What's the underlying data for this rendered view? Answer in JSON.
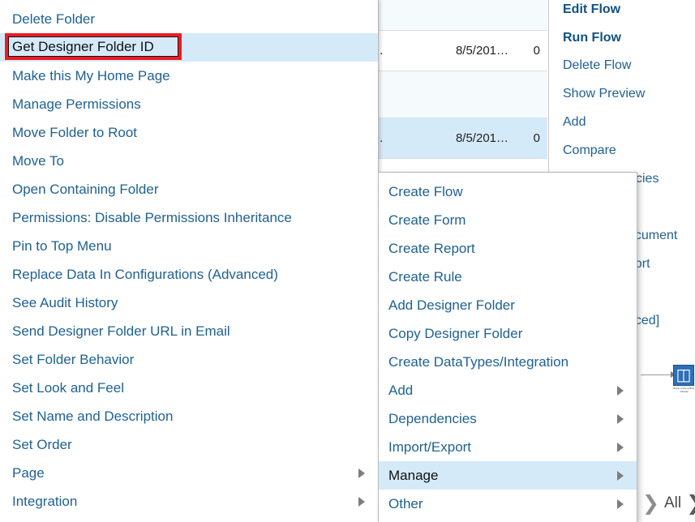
{
  "grid": {
    "rows": [
      {
        "truncated": "",
        "date": "",
        "count": "",
        "state": "alt"
      },
      {
        "truncated": "..",
        "date": "8/5/201…",
        "count": "0",
        "state": "white"
      },
      {
        "truncated": "",
        "date": "",
        "count": "",
        "state": "alt"
      },
      {
        "truncated": "..",
        "date": "8/5/201…",
        "count": "0",
        "state": "selected"
      },
      {
        "truncated": "",
        "date": "",
        "count": "",
        "state": "white"
      }
    ]
  },
  "right_panel": {
    "items": [
      {
        "label": "Edit Flow",
        "bold": true
      },
      {
        "label": "Run Flow",
        "bold": true
      },
      {
        "label": "Delete Flow",
        "bold": false
      },
      {
        "label": "Show Preview",
        "bold": false
      },
      {
        "label": "Add",
        "bold": false
      },
      {
        "label": "Compare",
        "bold": false
      }
    ],
    "clipped_items": [
      {
        "label": "…cies"
      },
      {
        "label": "…ocument"
      },
      {
        "label": "…port"
      },
      {
        "label": "…nced]"
      }
    ],
    "diagram": {
      "node_icon": "cube-icon",
      "node_caption": "Name of the artifact / Module"
    },
    "pager": {
      "prev_icon": "chevron-right-icon",
      "all_label": "All",
      "next_icon": "chevron-right-icon"
    }
  },
  "context_menu": {
    "name": "designer-folder-context-menu",
    "items": [
      {
        "label": "Delete Folder",
        "highlighted": false,
        "has_submenu": false
      },
      {
        "label": "Get Designer Folder ID",
        "highlighted": true,
        "has_submenu": false,
        "annotated": true
      },
      {
        "label": "Make this My Home Page",
        "highlighted": false,
        "has_submenu": false
      },
      {
        "label": "Manage Permissions",
        "highlighted": false,
        "has_submenu": false
      },
      {
        "label": "Move Folder to Root",
        "highlighted": false,
        "has_submenu": false
      },
      {
        "label": "Move To",
        "highlighted": false,
        "has_submenu": false
      },
      {
        "label": "Open Containing Folder",
        "highlighted": false,
        "has_submenu": false
      },
      {
        "label": "Permissions: Disable Permissions Inheritance",
        "highlighted": false,
        "has_submenu": false
      },
      {
        "label": "Pin to Top Menu",
        "highlighted": false,
        "has_submenu": false
      },
      {
        "label": "Replace Data In Configurations (Advanced)",
        "highlighted": false,
        "has_submenu": false
      },
      {
        "label": "See Audit History",
        "highlighted": false,
        "has_submenu": false
      },
      {
        "label": "Send Designer Folder URL in Email",
        "highlighted": false,
        "has_submenu": false
      },
      {
        "label": "Set Folder Behavior",
        "highlighted": false,
        "has_submenu": false
      },
      {
        "label": "Set Look and Feel",
        "highlighted": false,
        "has_submenu": false
      },
      {
        "label": "Set Name and Description",
        "highlighted": false,
        "has_submenu": false
      },
      {
        "label": "Set Order",
        "highlighted": false,
        "has_submenu": false
      },
      {
        "label": "Page",
        "highlighted": false,
        "has_submenu": true
      },
      {
        "label": "Integration",
        "highlighted": false,
        "has_submenu": true
      }
    ]
  },
  "context_submenu": {
    "name": "designer-folder-create-submenu",
    "items": [
      {
        "label": "Create Flow",
        "highlighted": false,
        "has_submenu": false
      },
      {
        "label": "Create Form",
        "highlighted": false,
        "has_submenu": false
      },
      {
        "label": "Create Report",
        "highlighted": false,
        "has_submenu": false
      },
      {
        "label": "Create Rule",
        "highlighted": false,
        "has_submenu": false
      },
      {
        "label": "Add Designer Folder",
        "highlighted": false,
        "has_submenu": false
      },
      {
        "label": "Copy Designer Folder",
        "highlighted": false,
        "has_submenu": false
      },
      {
        "label": "Create DataTypes/Integration",
        "highlighted": false,
        "has_submenu": false
      },
      {
        "label": "Add",
        "highlighted": false,
        "has_submenu": true
      },
      {
        "label": "Dependencies",
        "highlighted": false,
        "has_submenu": true
      },
      {
        "label": "Import/Export",
        "highlighted": false,
        "has_submenu": true
      },
      {
        "label": "Manage",
        "highlighted": true,
        "has_submenu": true
      },
      {
        "label": "Other",
        "highlighted": false,
        "has_submenu": true
      }
    ]
  },
  "annotation": {
    "type": "red-rectangle-highlight",
    "target_label": "Get Designer Folder ID",
    "color": "#ec1c24"
  },
  "colors": {
    "link": "#1f6193",
    "highlight_row": "#d5eaf8",
    "alt_row": "#f5fafd",
    "annotation_red": "#ec1c24"
  }
}
